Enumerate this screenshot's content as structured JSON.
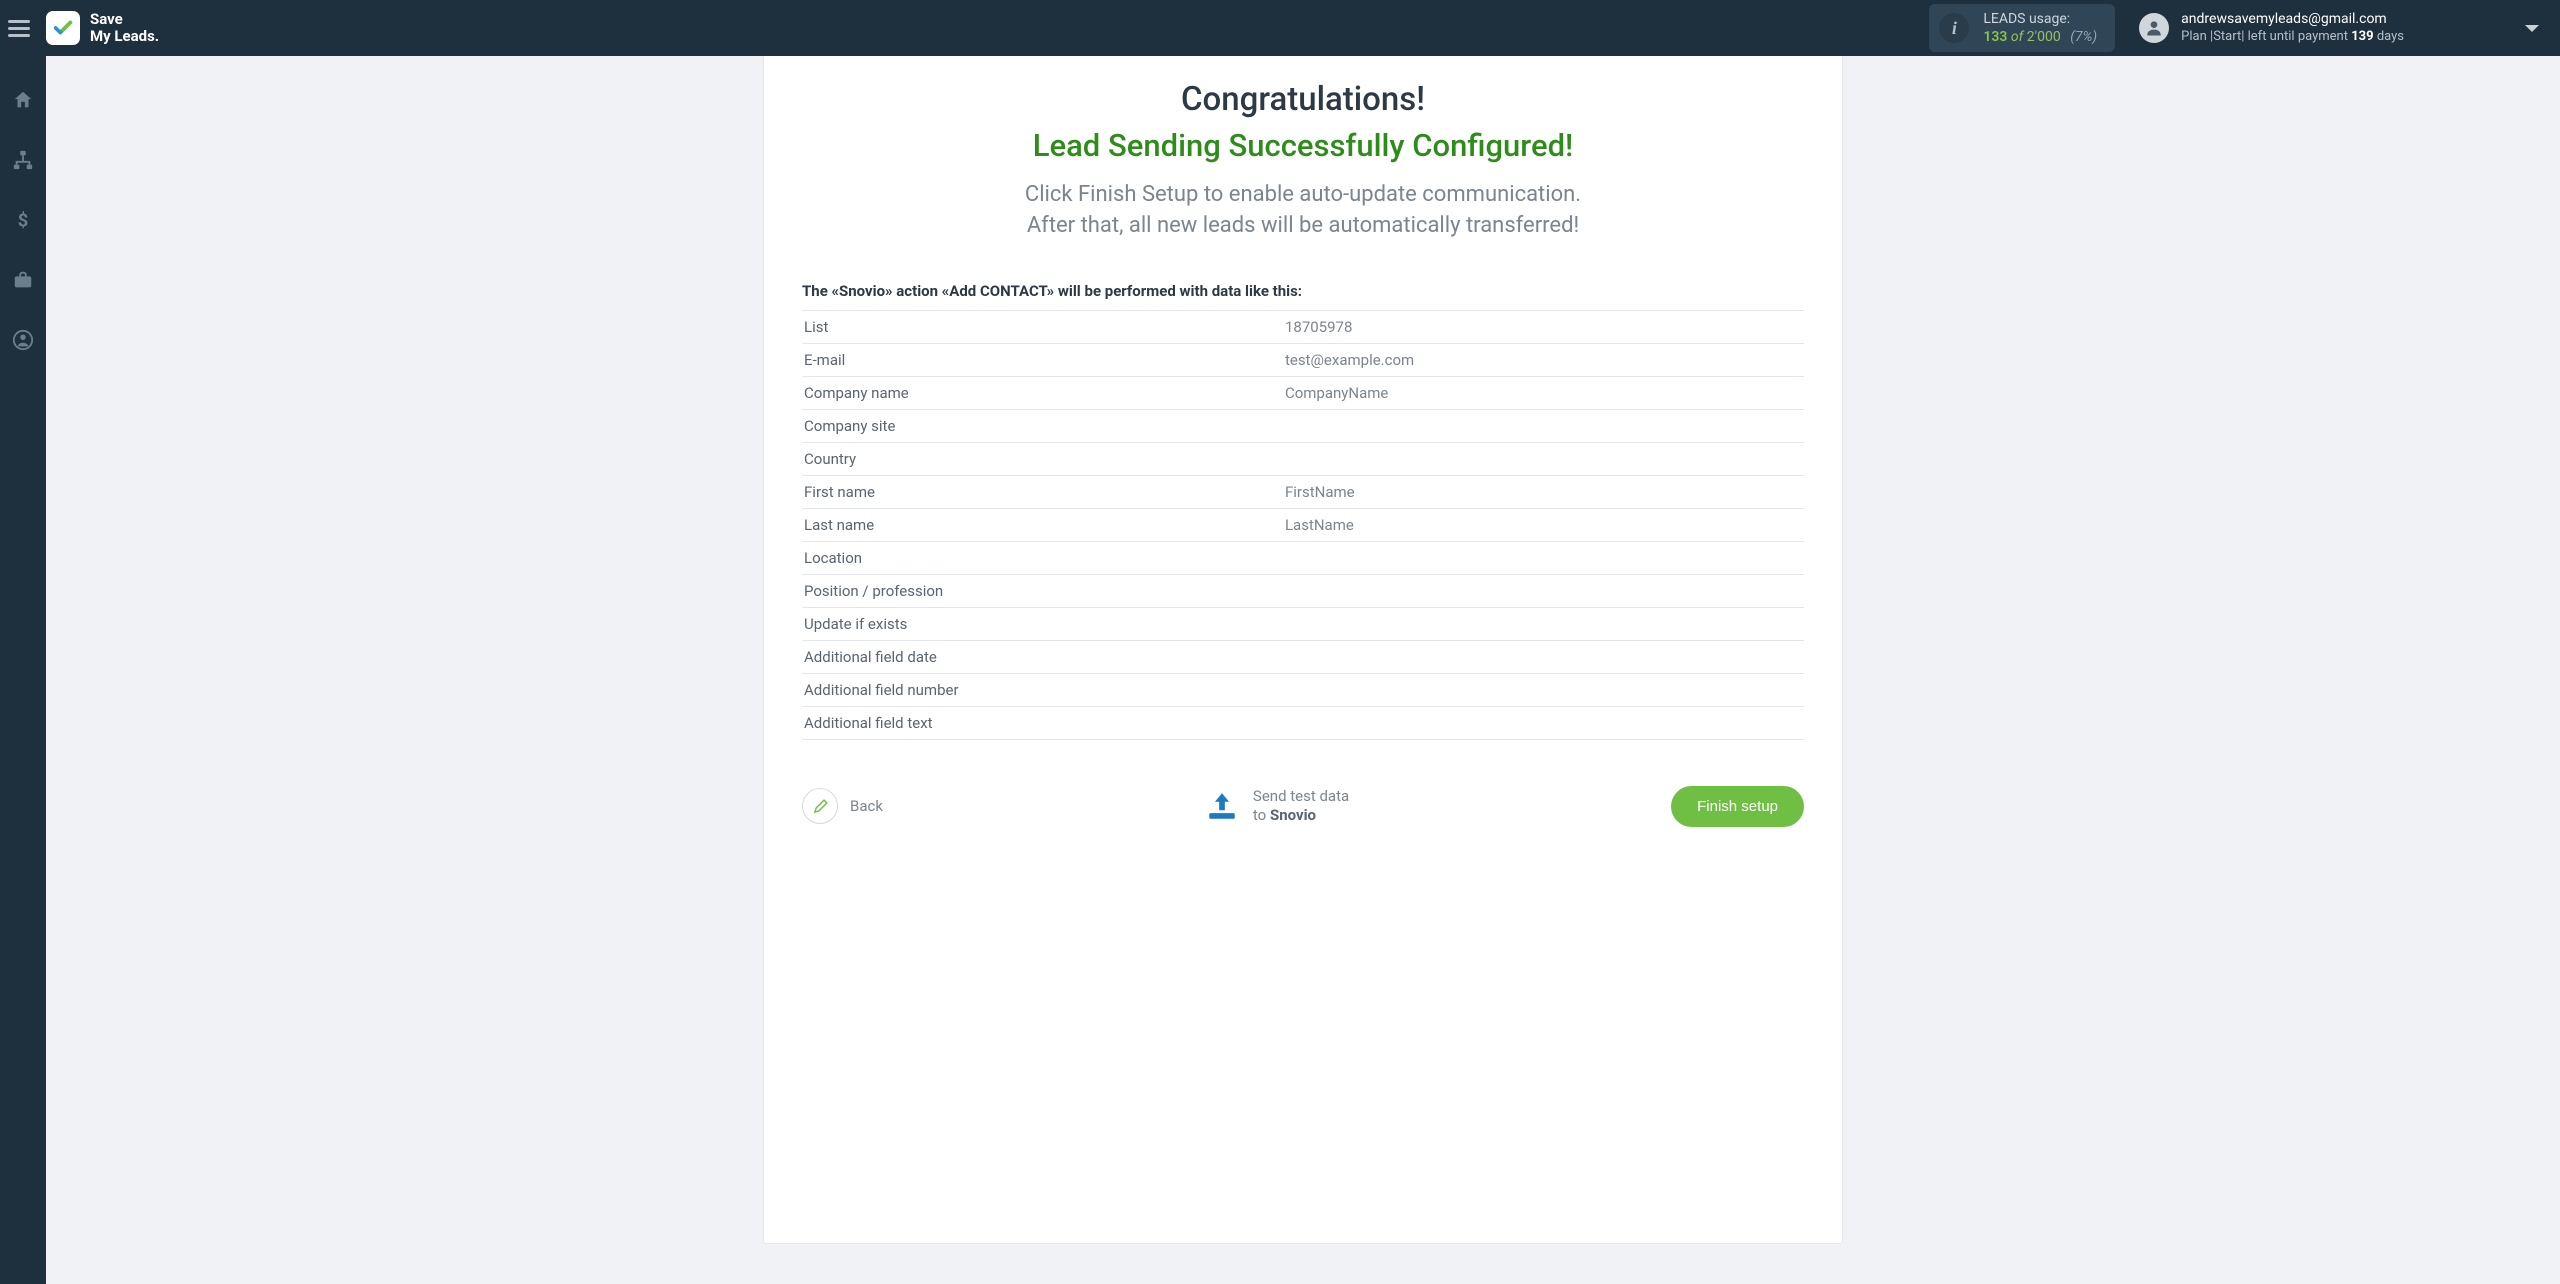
{
  "brand": {
    "line1": "Save",
    "line2": "My Leads."
  },
  "usage": {
    "title": "LEADS usage:",
    "count": "133",
    "of": "of",
    "total": "2'000",
    "pct": "(7%)"
  },
  "user": {
    "email": "andrewsavemyleads@gmail.com",
    "plan_prefix": "Plan |",
    "plan_name": "Start",
    "plan_mid": "| left until payment ",
    "days_value": "139",
    "days_suffix": " days"
  },
  "content": {
    "congrats": "Congratulations!",
    "success": "Lead Sending Successfully Configured!",
    "desc_line1": "Click Finish Setup to enable auto-update communication.",
    "desc_line2": "After that, all new leads will be automatically transferred!",
    "action_label": "The «Snovio» action «Add CONTACT» will be performed with data like this:"
  },
  "fields": [
    {
      "key": "List",
      "value": "18705978"
    },
    {
      "key": "E-mail",
      "value": "test@example.com"
    },
    {
      "key": "Company name",
      "value": "CompanyName"
    },
    {
      "key": "Company site",
      "value": ""
    },
    {
      "key": "Country",
      "value": ""
    },
    {
      "key": "First name",
      "value": "FirstName"
    },
    {
      "key": "Last name",
      "value": "LastName"
    },
    {
      "key": "Location",
      "value": ""
    },
    {
      "key": "Position / profession",
      "value": ""
    },
    {
      "key": "Update if exists",
      "value": ""
    },
    {
      "key": "Additional field date",
      "value": ""
    },
    {
      "key": "Additional field number",
      "value": ""
    },
    {
      "key": "Additional field text",
      "value": ""
    }
  ],
  "buttons": {
    "back": "Back",
    "send_line1": "Send test data",
    "send_to": "to ",
    "send_target": "Snovio",
    "finish": "Finish setup"
  }
}
